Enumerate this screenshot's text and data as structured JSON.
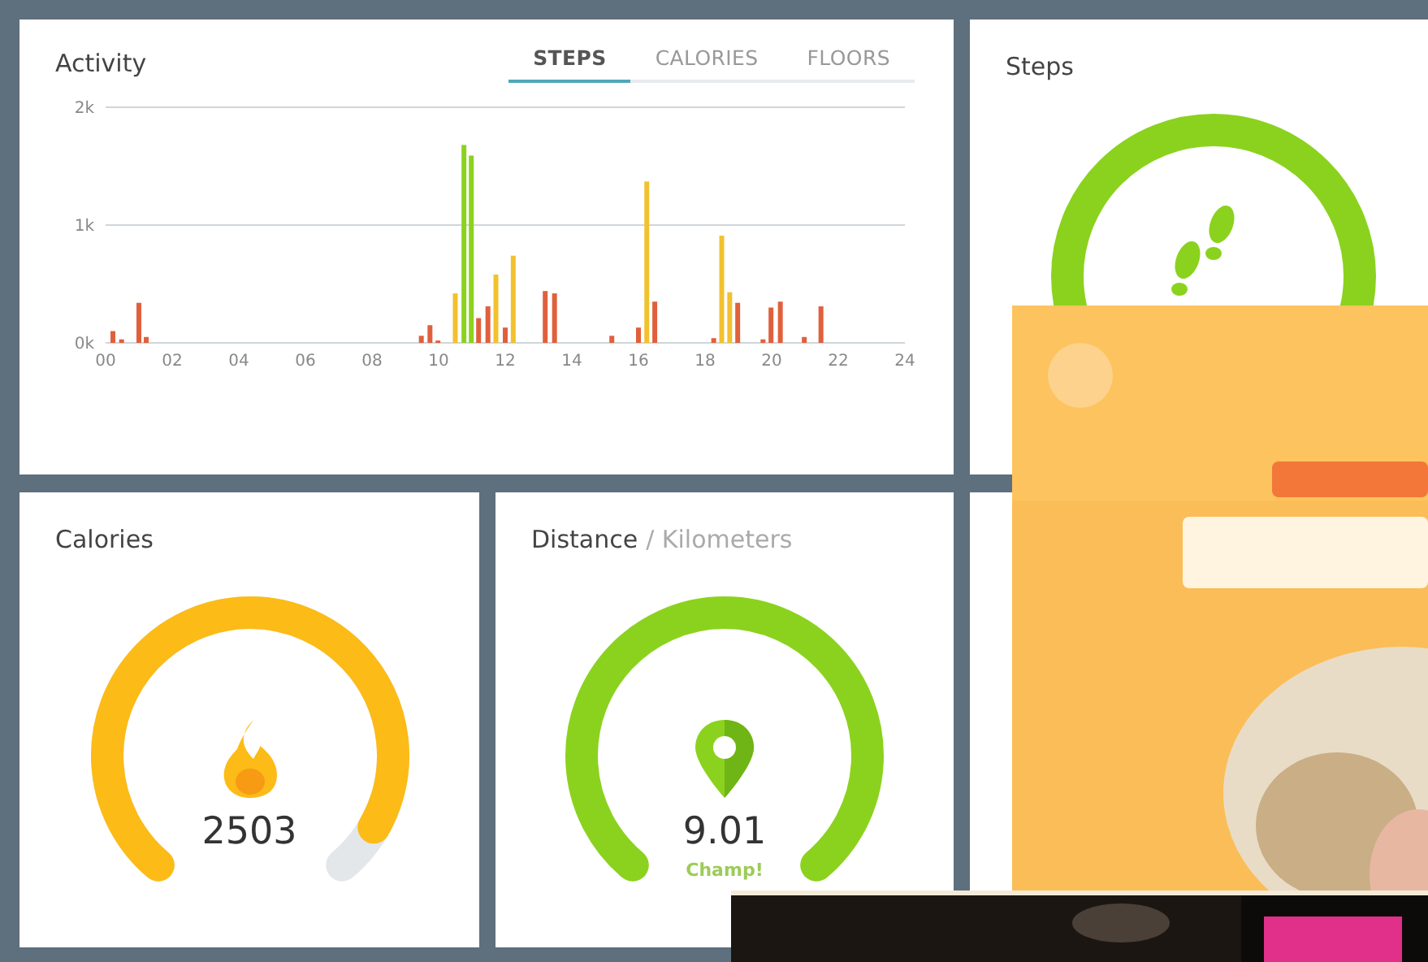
{
  "activity": {
    "title": "Activity",
    "tabs": [
      {
        "label": "STEPS",
        "selected": true
      },
      {
        "label": "CALORIES",
        "selected": false
      },
      {
        "label": "FLOORS",
        "selected": false
      }
    ],
    "chart_data": {
      "type": "bar",
      "stacked": true,
      "x": [
        0.22,
        0.48,
        1.0,
        1.22,
        9.48,
        9.74,
        9.98,
        10.5,
        10.76,
        10.98,
        11.2,
        11.48,
        11.72,
        12.0,
        12.24,
        13.2,
        13.48,
        15.2,
        16.0,
        16.25,
        16.49,
        18.26,
        18.5,
        18.74,
        18.98,
        19.74,
        19.98,
        20.26,
        20.98,
        21.48
      ],
      "xlim": [
        0,
        24
      ],
      "ylim": [
        0,
        2000
      ],
      "xticks": [
        {
          "value": 0,
          "label": "00"
        },
        {
          "value": 2,
          "label": "02"
        },
        {
          "value": 4,
          "label": "04"
        },
        {
          "value": 6,
          "label": "06"
        },
        {
          "value": 8,
          "label": "08"
        },
        {
          "value": 10,
          "label": "10"
        },
        {
          "value": 12,
          "label": "12"
        },
        {
          "value": 14,
          "label": "14"
        },
        {
          "value": 16,
          "label": "16"
        },
        {
          "value": 18,
          "label": "18"
        },
        {
          "value": 20,
          "label": "20"
        },
        {
          "value": 22,
          "label": "22"
        },
        {
          "value": 24,
          "label": "24"
        }
      ],
      "yticks": [
        {
          "value": 0,
          "label": "0k"
        },
        {
          "value": 1000,
          "label": "1k"
        },
        {
          "value": 2000,
          "label": "2k"
        }
      ],
      "series": [
        {
          "color": "#e0603c",
          "values": [
            100,
            30,
            340,
            50,
            60,
            150,
            20,
            null,
            null,
            null,
            210,
            310,
            null,
            130,
            null,
            440,
            420,
            60,
            130,
            null,
            350,
            40,
            null,
            null,
            340,
            30,
            300,
            350,
            50,
            310
          ]
        },
        {
          "color": "#f2c12e",
          "values": [
            null,
            null,
            null,
            null,
            null,
            null,
            null,
            420,
            null,
            null,
            null,
            null,
            580,
            null,
            740,
            null,
            null,
            null,
            null,
            1370,
            null,
            null,
            910,
            430,
            null,
            null,
            null,
            null,
            null,
            null
          ]
        },
        {
          "color": "#8bd21e",
          "values": [
            null,
            null,
            null,
            null,
            null,
            null,
            null,
            null,
            1680,
            1590,
            null,
            null,
            null,
            null,
            null,
            null,
            null,
            null,
            null,
            null,
            null,
            null,
            null,
            null,
            null,
            null,
            null,
            null,
            null,
            null
          ]
        }
      ]
    }
  },
  "steps": {
    "title": "Steps"
  },
  "calories": {
    "title": "Calories",
    "value": "2503"
  },
  "distance": {
    "title": "Distance",
    "unit": "/ Kilometers",
    "value": "9.01",
    "note": "Champ!"
  }
}
